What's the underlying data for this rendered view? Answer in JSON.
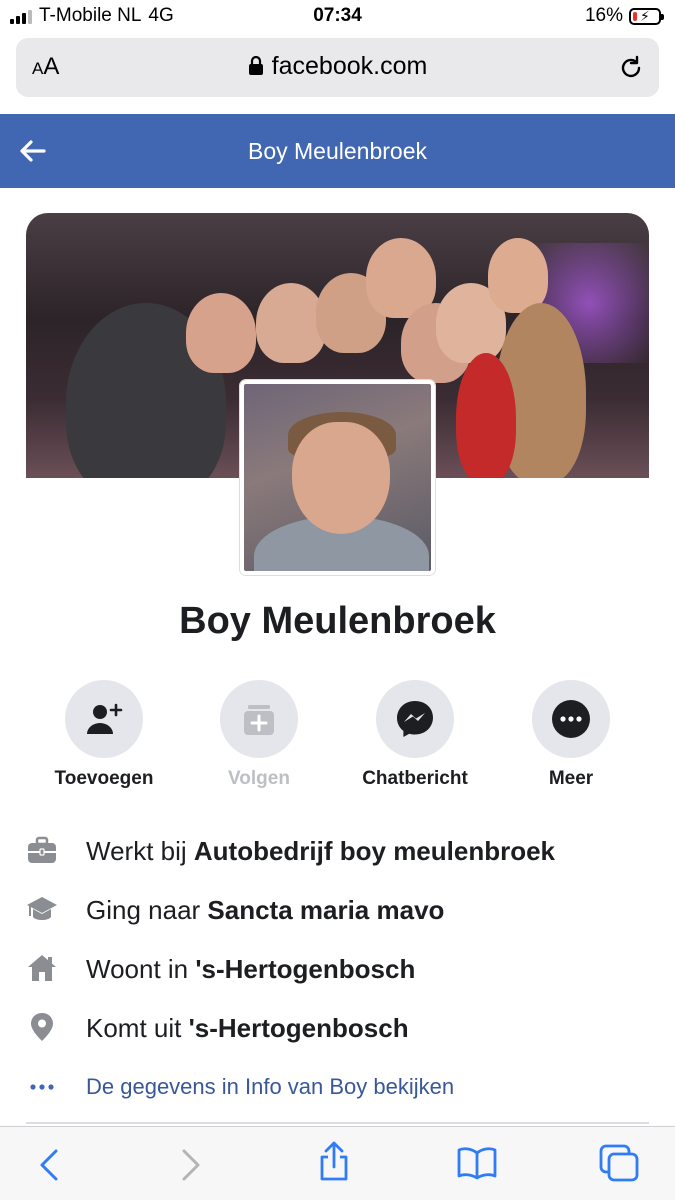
{
  "status_bar": {
    "carrier": "T-Mobile NL",
    "network": "4G",
    "time": "07:34",
    "battery": "16%",
    "battery_level": 0.16
  },
  "browser": {
    "text_size_label_small": "A",
    "text_size_label_large": "A",
    "url": "facebook.com"
  },
  "header": {
    "title": "Boy Meulenbroek"
  },
  "profile": {
    "name": "Boy Meulenbroek"
  },
  "actions": [
    {
      "label": "Toevoegen",
      "icon": "add-friend-icon",
      "enabled": true
    },
    {
      "label": "Volgen",
      "icon": "follow-icon",
      "enabled": false
    },
    {
      "label": "Chatbericht",
      "icon": "messenger-icon",
      "enabled": true
    },
    {
      "label": "Meer",
      "icon": "more-icon",
      "enabled": true
    }
  ],
  "info": {
    "work_prefix": "Werkt bij ",
    "work_value": "Autobedrijf boy meulenbroek",
    "education_prefix": "Ging naar ",
    "education_value": "Sancta maria mavo",
    "lives_prefix": "Woont in ",
    "lives_value": "'s-Hertogenbosch",
    "from_prefix": "Komt uit ",
    "from_value": "'s-Hertogenbosch",
    "see_more": "De gegevens in Info van Boy bekijken"
  },
  "colors": {
    "facebook_blue": "#4267b2",
    "link_blue": "#385898",
    "button_grey": "#e4e6eb",
    "safari_blue": "#2f7cf6"
  }
}
